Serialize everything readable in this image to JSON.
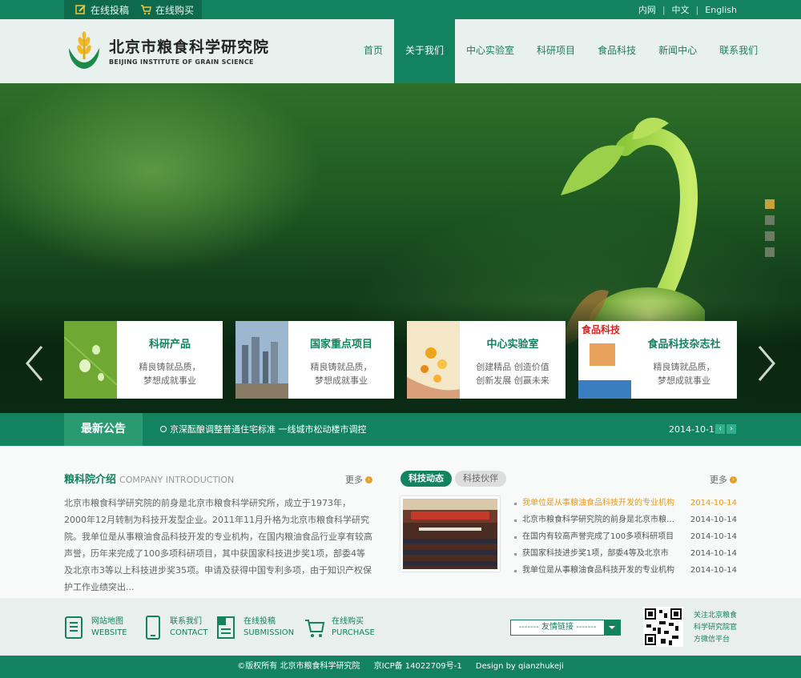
{
  "topbar": {
    "quick_links": [
      {
        "label": "在线投稿",
        "icon": "edit-icon"
      },
      {
        "label": "在线购买",
        "icon": "cart-icon"
      }
    ],
    "languages": [
      "内网",
      "中文",
      "English"
    ]
  },
  "header": {
    "logo_cn": "北京市粮食科学研究院",
    "logo_en": "BEIJING INSTITUTE OF GRAIN SCIENCE",
    "nav": [
      "首页",
      "关于我们",
      "中心实验室",
      "科研项目",
      "食品科技",
      "新闻中心",
      "联系我们"
    ],
    "active_nav": "关于我们"
  },
  "hero": {
    "cards": [
      {
        "title": "科研产品",
        "line1": "精良铸就品质，",
        "line2": "梦想成就事业"
      },
      {
        "title": "国家重点项目",
        "line1": "精良铸就品质，",
        "line2": "梦想成就事业"
      },
      {
        "title": "中心实验室",
        "line1": "创建精品  创造价值",
        "line2": "创新发展  创赢未来"
      },
      {
        "title": "食品科技杂志社",
        "line1": "精良铸就品质，",
        "line2": "梦想成就事业",
        "cover_title": "食品科技"
      }
    ]
  },
  "notice": {
    "label": "最新公告",
    "text": "京深酝酿调整普通住宅标准 一线城市松动楼市调控",
    "date": "2014-10-13",
    "prev": "‹",
    "next": "›"
  },
  "intro": {
    "title": "粮科院介绍",
    "subtitle": "COMPANY INTRODUCTION",
    "more": "更多",
    "text": "北京市粮食科学研究院的前身是北京市粮食科学研究所，成立于1973年，2000年12月转制为科技开发型企业。2011年11月升格为北京市粮食科学研究院。我单位是从事粮油食品科技开发的专业机构，在国内粮油食品行业享有较高声誉，历年来完成了100多项科研项目，其中获国家科技进步奖1项，部委4等及北京市3等以上科技进步奖35项。申请及获得中国专利多项，由于知识产权保护工作业绩突出..."
  },
  "news": {
    "tabs": [
      "科技动态",
      "科技伙伴"
    ],
    "more": "更多",
    "items": [
      {
        "title": "我单位是从事粮油食品科技开发的专业机构",
        "date": "2014-10-14"
      },
      {
        "title": "北京市粮食科学研究院的前身是北京市粮食科...",
        "date": "2014-10-14"
      },
      {
        "title": "在国内有较高声誉完成了100多项科研项目",
        "date": "2014-10-14"
      },
      {
        "title": "获国家科技进步奖1项，部委4等及北京市",
        "date": "2014-10-14"
      },
      {
        "title": "我单位是从事粮油食品科技开发的专业机构",
        "date": "2014-10-14"
      }
    ]
  },
  "footer": {
    "links": [
      {
        "cn": "网站地图",
        "en": "WEBSITE"
      },
      {
        "cn": "联系我们",
        "en": "CONTACT"
      },
      {
        "cn": "在线投稿",
        "en": "SUBMISSION"
      },
      {
        "cn": "在线购买",
        "en": "PURCHASE"
      }
    ],
    "friend_links": "------- 友情链接 -------",
    "qr_text": [
      "关注北京粮食",
      "科学研究院官",
      "方微信平台"
    ],
    "copyright": "©版权所有  北京市粮食科学研究院",
    "icp": "京ICP备 14022709号-1",
    "design": "Design by qianzhukeji"
  },
  "colors": {
    "primary": "#13825e",
    "accent": "#e0a12a"
  }
}
